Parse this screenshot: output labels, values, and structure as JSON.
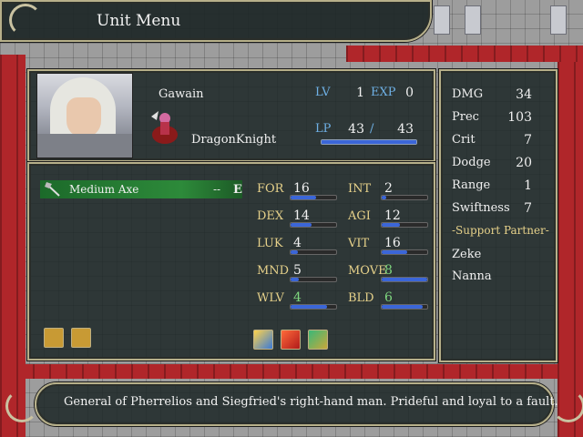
{
  "window": {
    "title": "Unit Menu"
  },
  "unit": {
    "name": "Gawain",
    "class": "DragonKnight",
    "lv_label": "LV",
    "lv": "1",
    "exp_label": "EXP",
    "exp": "0",
    "lp_label": "LP",
    "lp_current": "43",
    "lp_sep": "/",
    "lp_max": "43",
    "lp_fill": 1.0
  },
  "weapon": {
    "name": "Medium Axe",
    "uses": "--",
    "equipped": "E",
    "icon": "axe-icon"
  },
  "stats": [
    {
      "label": "FOR",
      "value": "16",
      "fill": 0.55,
      "highlight": false
    },
    {
      "label": "INT",
      "value": "2",
      "fill": 0.1,
      "highlight": false
    },
    {
      "label": "DEX",
      "value": "14",
      "fill": 0.45,
      "highlight": false
    },
    {
      "label": "AGI",
      "value": "12",
      "fill": 0.4,
      "highlight": false
    },
    {
      "label": "LUK",
      "value": "4",
      "fill": 0.15,
      "highlight": false
    },
    {
      "label": "VIT",
      "value": "16",
      "fill": 0.55,
      "highlight": false
    },
    {
      "label": "MND",
      "value": "5",
      "fill": 0.18,
      "highlight": false
    },
    {
      "label": "MOVE",
      "value": "8",
      "fill": 1.0,
      "highlight": true
    },
    {
      "label": "WLV",
      "value": "4",
      "fill": 0.8,
      "highlight": true
    },
    {
      "label": "BLD",
      "value": "6",
      "fill": 0.9,
      "highlight": true
    }
  ],
  "combat": [
    {
      "label": "DMG",
      "value": "34"
    },
    {
      "label": "Prec",
      "value": "103"
    },
    {
      "label": "Crit",
      "value": "7"
    },
    {
      "label": "Dodge",
      "value": "20"
    },
    {
      "label": "Range",
      "value": "1"
    },
    {
      "label": "Swiftness",
      "value": "7"
    }
  ],
  "support": {
    "header": "-Support Partner-",
    "partners": [
      "Zeke",
      "Nanna"
    ]
  },
  "description": "General of Pherrelios and Siegfried's right-hand man. Prideful and loyal to a fault.",
  "icons": {
    "inventory": [
      "axe-icon",
      "axe-icon"
    ],
    "skills": [
      "burst-skill-icon",
      "sword-slash-skill-icon",
      "grail-skill-icon"
    ]
  }
}
